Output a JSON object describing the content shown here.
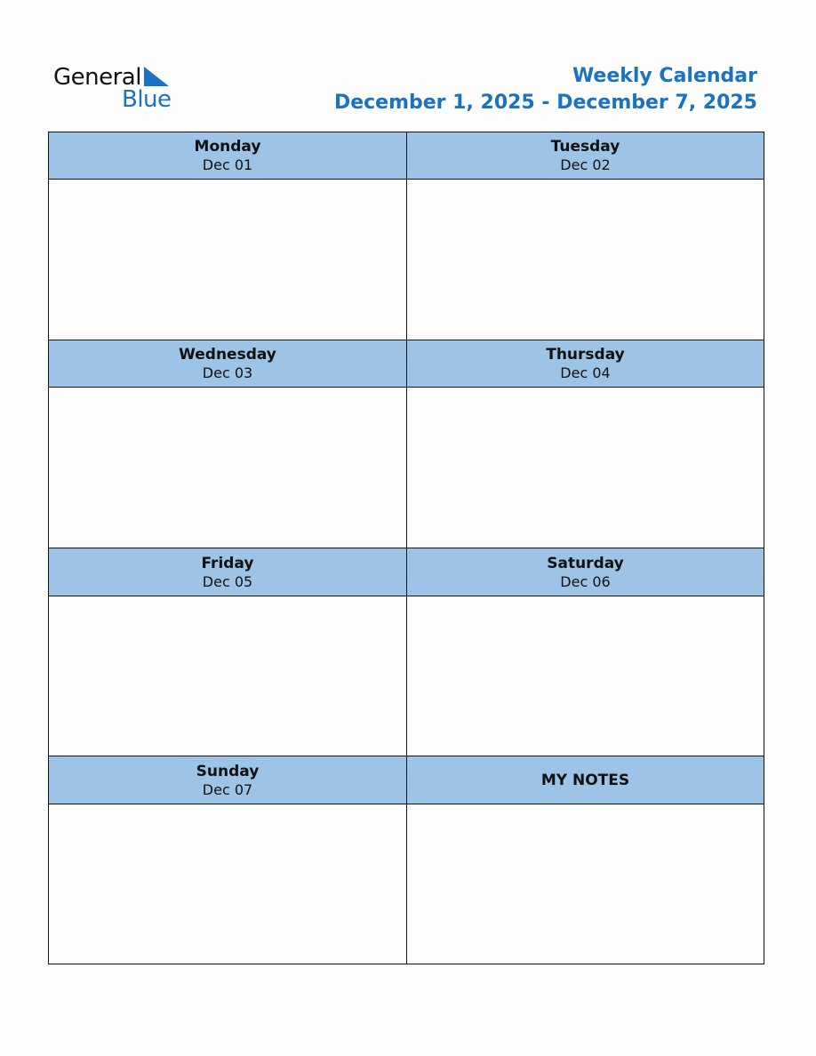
{
  "logo": {
    "line1": "General",
    "line2": "Blue"
  },
  "header": {
    "title": "Weekly Calendar",
    "range": "December 1, 2025 - December 7, 2025"
  },
  "colors": {
    "accent": "#1a72c0",
    "header_bg": "#9dc3e6",
    "border": "#111111"
  },
  "days": [
    {
      "name": "Monday",
      "date": "Dec 01"
    },
    {
      "name": "Tuesday",
      "date": "Dec 02"
    },
    {
      "name": "Wednesday",
      "date": "Dec 03"
    },
    {
      "name": "Thursday",
      "date": "Dec 04"
    },
    {
      "name": "Friday",
      "date": "Dec 05"
    },
    {
      "name": "Saturday",
      "date": "Dec 06"
    },
    {
      "name": "Sunday",
      "date": "Dec 07"
    }
  ],
  "notes": {
    "label": "MY NOTES"
  }
}
